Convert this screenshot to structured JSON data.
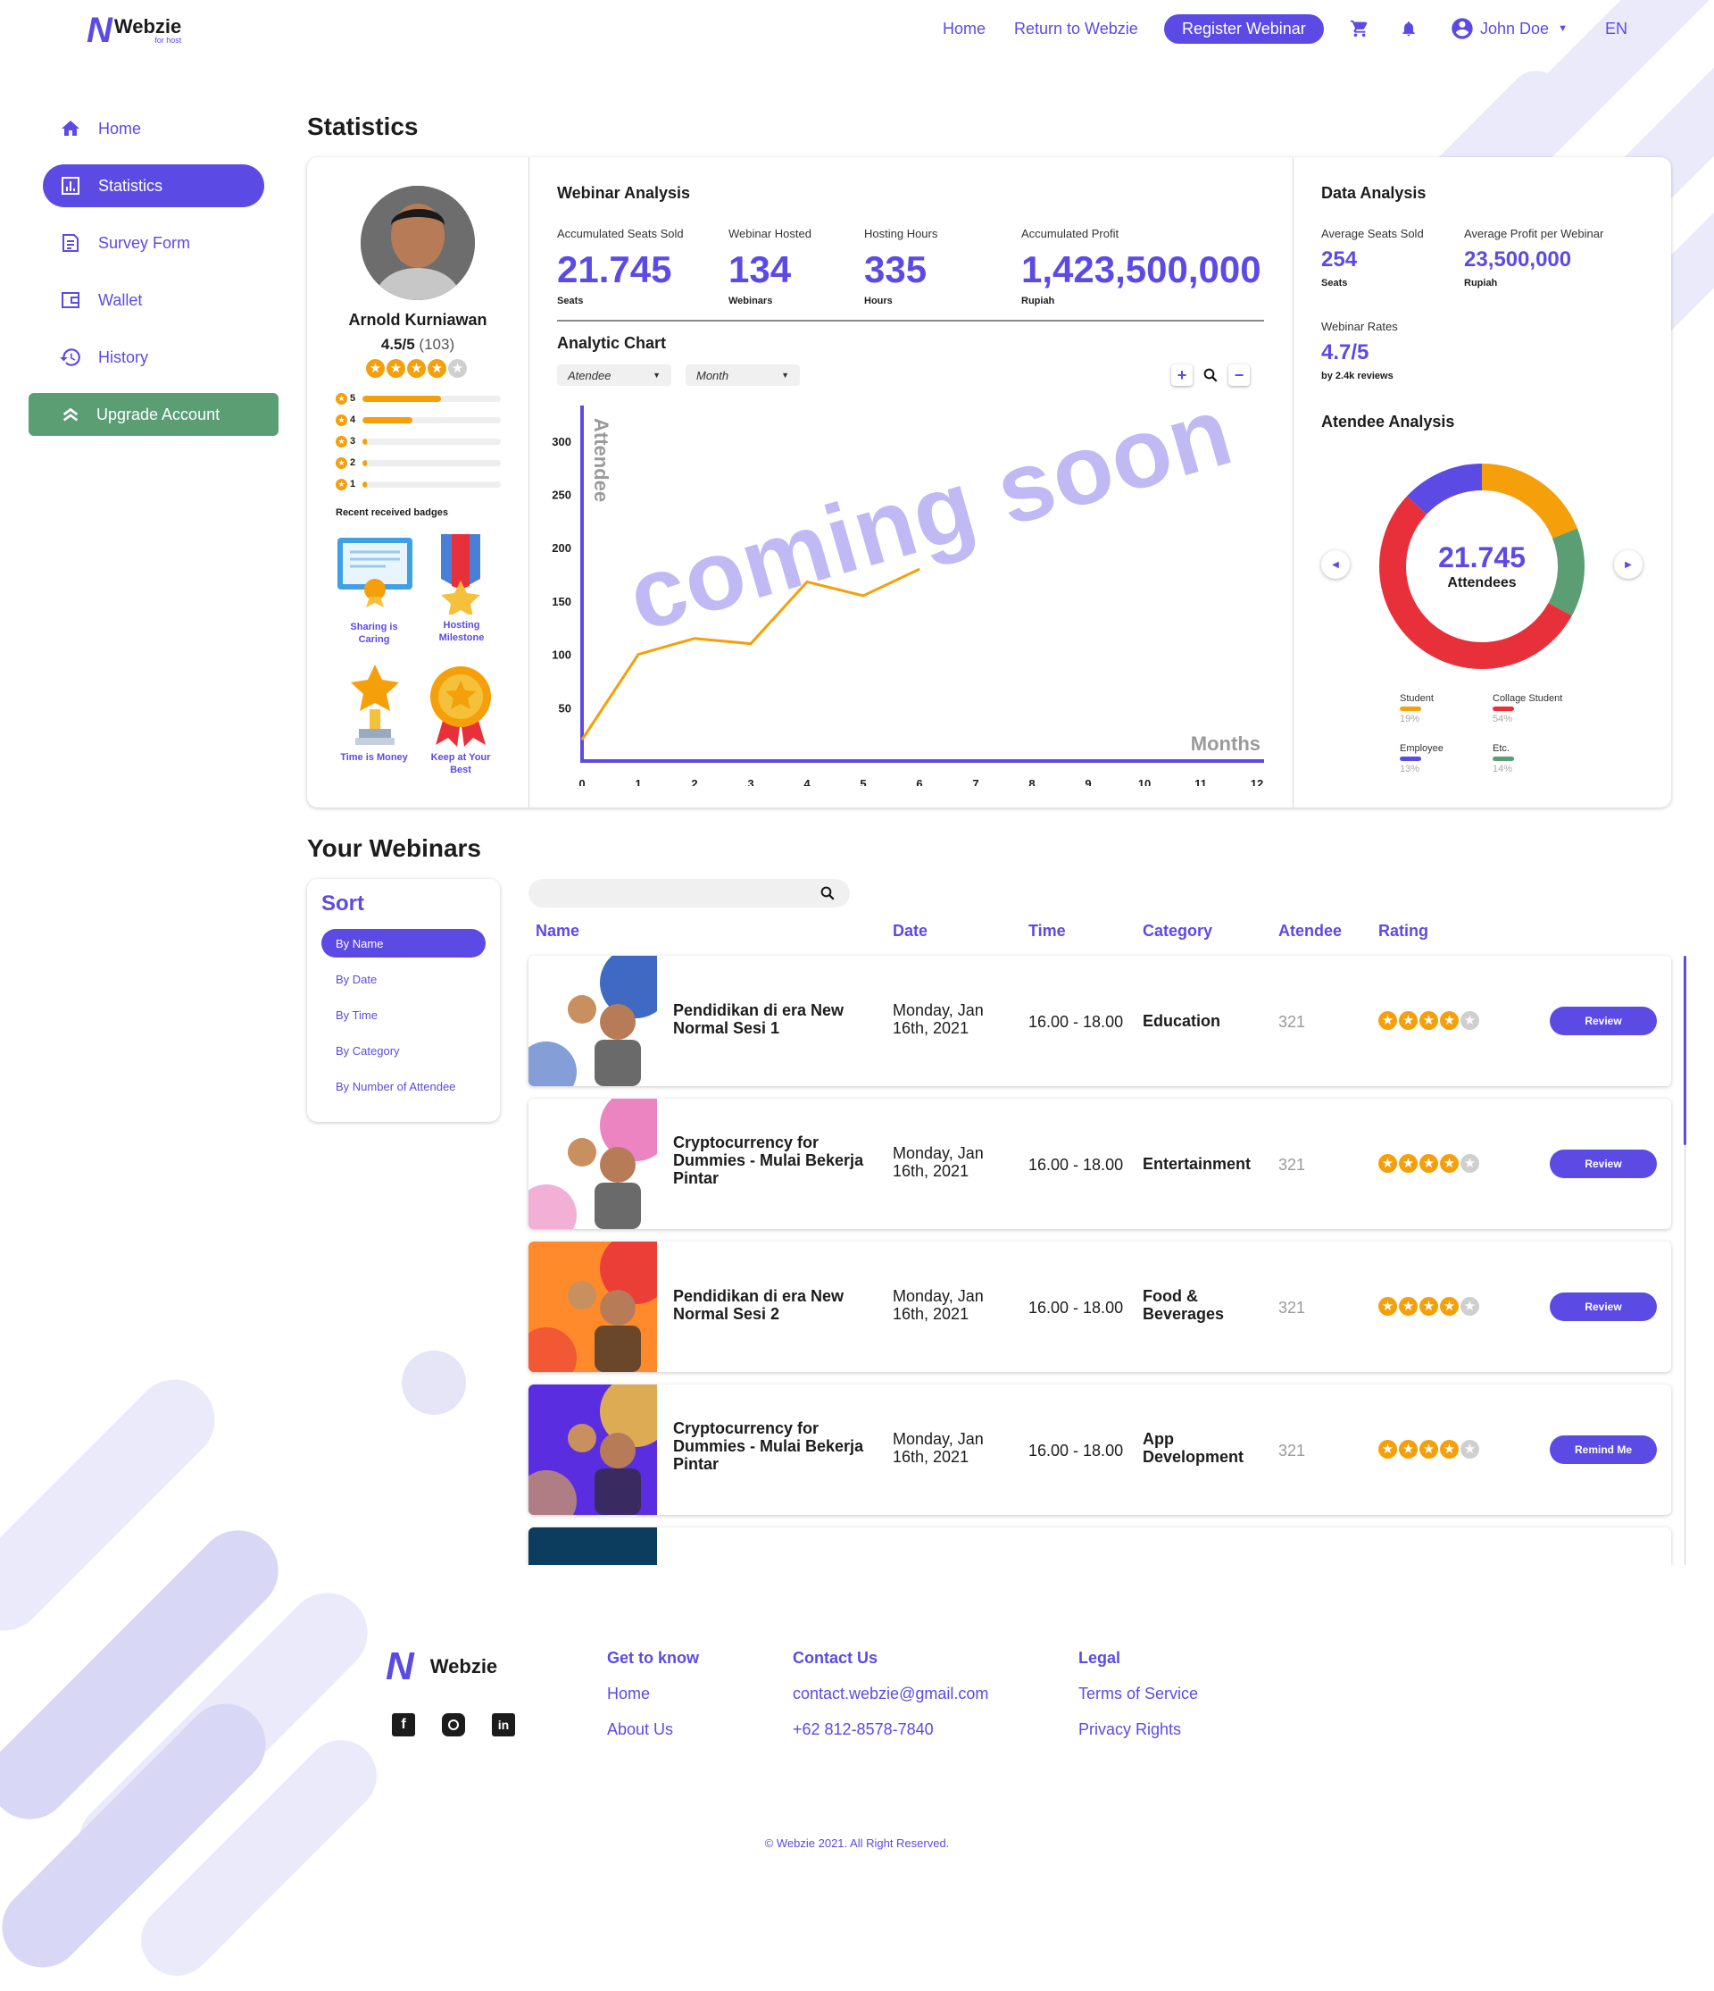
{
  "brand": {
    "name": "Webzie",
    "sub": "for host"
  },
  "header": {
    "home": "Home",
    "return": "Return to Webzie",
    "register": "Register Webinar",
    "user": "John Doe",
    "lang": "EN"
  },
  "sidebar": {
    "items": [
      {
        "label": "Home",
        "icon": "home-icon"
      },
      {
        "label": "Statistics",
        "icon": "chart-icon"
      },
      {
        "label": "Survey Form",
        "icon": "survey-icon"
      },
      {
        "label": "Wallet",
        "icon": "wallet-icon"
      },
      {
        "label": "History",
        "icon": "history-icon"
      }
    ],
    "upgrade": "Upgrade Account"
  },
  "statistics": {
    "title": "Statistics",
    "profile": {
      "name": "Arnold Kurniawan",
      "rating": "4.5/5",
      "count": "(103)",
      "stars": 4.5,
      "bars": [
        {
          "star": "5",
          "fraction": 0.57
        },
        {
          "star": "4",
          "fraction": 0.36
        },
        {
          "star": "3",
          "fraction": 0.03
        },
        {
          "star": "2",
          "fraction": 0.03
        },
        {
          "star": "1",
          "fraction": 0.03
        }
      ],
      "badges_title": "Recent received badges",
      "badges": [
        "Sharing is Caring",
        "Hosting Milestone",
        "Time is Money",
        "Keep at Your Best"
      ]
    },
    "webinar_analysis": {
      "title": "Webinar Analysis",
      "metrics": [
        {
          "label": "Accumulated Seats Sold",
          "value": "21.745",
          "unit": "Seats"
        },
        {
          "label": "Webinar Hosted",
          "value": "134",
          "unit": "Webinars"
        },
        {
          "label": "Hosting Hours",
          "value": "335",
          "unit": "Hours"
        },
        {
          "label": "Accumulated Profit",
          "value": "1,423,500,000",
          "unit": "Rupiah"
        }
      ],
      "chart_title": "Analytic Chart",
      "dropdown1": "Atendee",
      "dropdown2": "Month",
      "overlay": "coming soon"
    },
    "data_analysis": {
      "title": "Data Analysis",
      "avg_seats_label": "Average Seats Sold",
      "avg_seats": "254",
      "avg_seats_unit": "Seats",
      "avg_profit_label": "Average Profit per Webinar",
      "avg_profit": "23,500,000",
      "avg_profit_unit": "Rupiah",
      "rates_label": "Webinar Rates",
      "rates": "4.7/5",
      "reviews": "by 2.4k reviews",
      "attendee_title": "Atendee Analysis",
      "total": "21.745",
      "total_label": "Attendees",
      "legend": [
        {
          "name": "Student",
          "pct": "19%",
          "color": "#f59f0a"
        },
        {
          "name": "Collage Student",
          "pct": "54%",
          "color": "#e8303a"
        },
        {
          "name": "Employee",
          "pct": "13%",
          "color": "#5c4ae4"
        },
        {
          "name": "Etc.",
          "pct": "14%",
          "color": "#5b9e74"
        }
      ]
    }
  },
  "chart_data": {
    "type": "line",
    "title": "Analytic Chart",
    "xlabel": "Months",
    "ylabel": "Attendee",
    "x": [
      0,
      1,
      2,
      3,
      4,
      5,
      6
    ],
    "series": [
      {
        "values": [
          20,
          100,
          115,
          110,
          168,
          155,
          180
        ]
      }
    ],
    "xticks": [
      "0",
      "1",
      "2",
      "3",
      "4",
      "5",
      "6",
      "7",
      "8",
      "9",
      "10",
      "11",
      "12"
    ],
    "yticks": [
      "50",
      "100",
      "150",
      "200",
      "250",
      "300"
    ],
    "xlim": [
      0,
      12
    ],
    "ylim": [
      0,
      325
    ],
    "grid": false
  },
  "attendee_pie": {
    "type": "pie",
    "slices": [
      {
        "name": "Student",
        "value": 19,
        "color": "#f59f0a"
      },
      {
        "name": "Etc.",
        "value": 14,
        "color": "#5b9e74"
      },
      {
        "name": "Collage Student",
        "value": 54,
        "color": "#e8303a"
      },
      {
        "name": "Employee",
        "value": 13,
        "color": "#5c4ae4"
      }
    ]
  },
  "webinars": {
    "title": "Your Webinars",
    "sort_title": "Sort",
    "sort_options": [
      "By Name",
      "By Date",
      "By Time",
      "By Category",
      "By Number of Attendee"
    ],
    "columns": [
      "Name",
      "Date",
      "Time",
      "Category",
      "Atendee",
      "Rating"
    ],
    "rows": [
      {
        "name": "Pendidikan di era New Normal Sesi 1",
        "date": "Monday, Jan 16th, 2021",
        "time": "16.00 - 18.00",
        "category": "Education",
        "attendee": "321",
        "rating": 4.5,
        "action": "Review",
        "thumb_bg": "#ffffff",
        "thumb_accent": "#1f4fb8"
      },
      {
        "name": "Cryptocurrency for Dummies - Mulai Bekerja Pintar",
        "date": "Monday, Jan 16th, 2021",
        "time": "16.00 - 18.00",
        "category": "Entertainment",
        "attendee": "321",
        "rating": 4.5,
        "action": "Review",
        "thumb_bg": "#ffffff",
        "thumb_accent": "#e86fb5"
      },
      {
        "name": "Pendidikan di era New Normal Sesi 2",
        "date": "Monday, Jan 16th, 2021",
        "time": "16.00 - 18.00",
        "category": "Food & Beverages",
        "attendee": "321",
        "rating": 4.5,
        "action": "Review",
        "thumb_bg": "#ff8a2b",
        "thumb_accent": "#e8303a"
      },
      {
        "name": "Cryptocurrency for Dummies - Mulai Bekerja Pintar",
        "date": "Monday, Jan 16th, 2021",
        "time": "16.00 - 18.00",
        "category": "App Development",
        "attendee": "321",
        "rating": 4.5,
        "action": "Remind Me",
        "thumb_bg": "#5a2ee0",
        "thumb_accent": "#f5c13a"
      }
    ]
  },
  "footer": {
    "brand": "Webzie",
    "get_to_know": "Get to know",
    "gtk_links": [
      "Home",
      "About Us"
    ],
    "contact": "Contact Us",
    "email": "contact.webzie@gmail.com",
    "phone": "+62 812-8578-7840",
    "legal": "Legal",
    "legal_links": [
      "Terms of Service",
      "Privacy Rights"
    ],
    "copyright": "© Webzie 2021. All Right Reserved."
  }
}
